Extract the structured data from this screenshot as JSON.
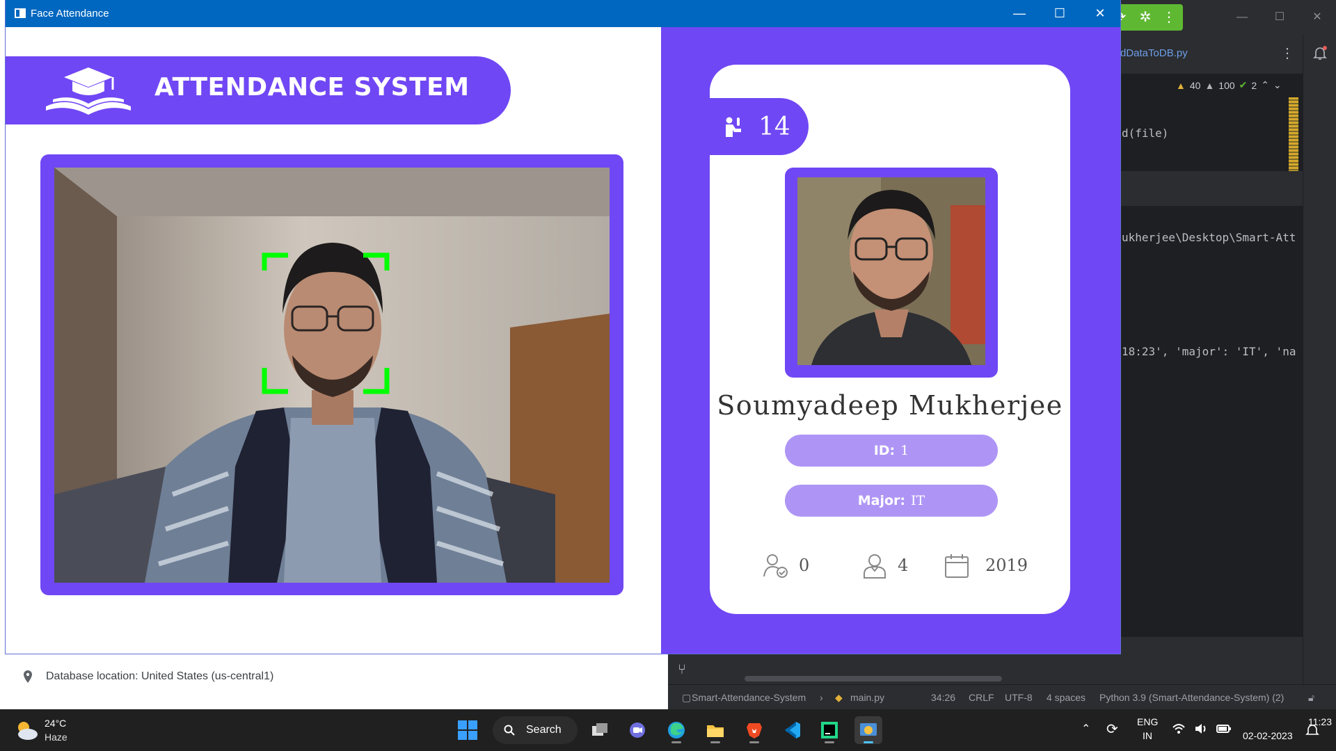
{
  "window": {
    "title": "Face Attendance",
    "controls": {
      "minimize": "—",
      "maximize": "☐",
      "close": "✕"
    }
  },
  "header": {
    "title": "ATTENDANCE SYSTEM"
  },
  "student": {
    "attendance_count": "14",
    "name": "Soumyadeep Mukherjee",
    "id_label": "ID:",
    "id_value": "1",
    "major_label": "Major:",
    "major_value": "IT",
    "stats": {
      "status_value": "0",
      "standing_value": "4",
      "starting_year": "2019"
    }
  },
  "colors": {
    "accent": "#7047f4",
    "pill": "#ae95f5",
    "face_box": "#00ff00"
  },
  "ide": {
    "tab": "dDataToDB.py",
    "inspections": {
      "warnings": "40",
      "weak_warnings": "100",
      "ok": "2"
    },
    "code_lines": [
      "d(file)",
      "ukherjee\\Desktop\\Smart-Att",
      "18:23', 'major': 'IT', 'na"
    ],
    "statusbar": {
      "project": "Smart-Attendance-System",
      "file": "main.py",
      "position": "34:26",
      "line_sep": "CRLF",
      "encoding": "UTF-8",
      "indent": "4 spaces",
      "interpreter": "Python 3.9 (Smart-Attendance-System) (2)"
    }
  },
  "browser": {
    "db_location": "Database location: United States (us-central1)"
  },
  "taskbar": {
    "weather_temp": "24°C",
    "weather_desc": "Haze",
    "search_label": "Search",
    "lang_line1": "ENG",
    "lang_line2": "IN",
    "time": "11:23",
    "date": "02-02-2023"
  }
}
